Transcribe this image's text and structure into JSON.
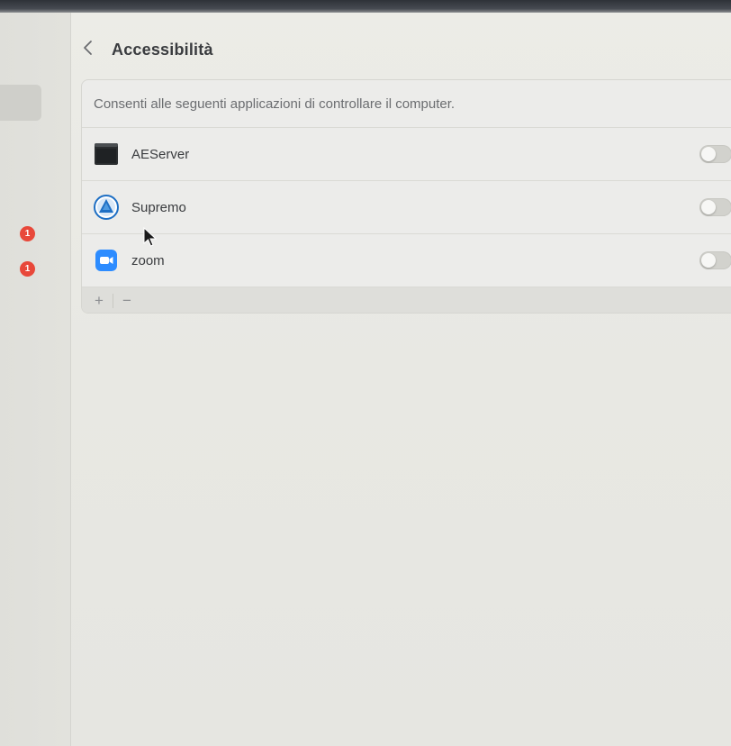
{
  "header": {
    "title": "Accessibilità",
    "back_icon": "chevron-left-icon"
  },
  "panel": {
    "description": "Consenti alle seguenti applicazioni di controllare il computer.",
    "apps": [
      {
        "name": "AEServer",
        "icon": "terminal-app-icon",
        "enabled": false
      },
      {
        "name": "Supremo",
        "icon": "supremo-app-icon",
        "enabled": false
      },
      {
        "name": "zoom",
        "icon": "zoom-app-icon",
        "enabled": false
      }
    ],
    "footer": {
      "add_label": "+",
      "remove_label": "−"
    }
  },
  "sidebar": {
    "badges": [
      "1",
      "1"
    ]
  },
  "colors": {
    "badge": "#e8483a",
    "toggle_off": "#d2d2cd",
    "zoom_blue": "#2d8cff",
    "supremo_blue": "#1e6fc4"
  }
}
